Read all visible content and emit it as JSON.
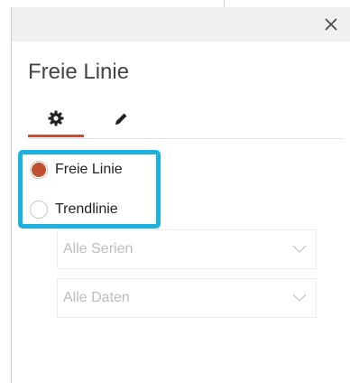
{
  "pane": {
    "title": "Freie Linie",
    "close_icon": "close-icon",
    "tabs": [
      {
        "name": "settings",
        "icon": "gear-icon",
        "active": true
      },
      {
        "name": "format",
        "icon": "pencil-icon",
        "active": false
      }
    ]
  },
  "line_type": {
    "options": [
      {
        "label": "Freie Linie",
        "selected": true
      },
      {
        "label": "Trendlinie",
        "selected": false
      }
    ]
  },
  "dropdowns": {
    "series": {
      "value": "Alle Serien",
      "icon": "chevron-down-icon"
    },
    "data": {
      "value": "Alle Daten",
      "icon": "chevron-down-icon"
    }
  },
  "colors": {
    "accent": "#c0502e",
    "highlight": "#1ab3e0",
    "titlebar": "#f0f0f0"
  }
}
